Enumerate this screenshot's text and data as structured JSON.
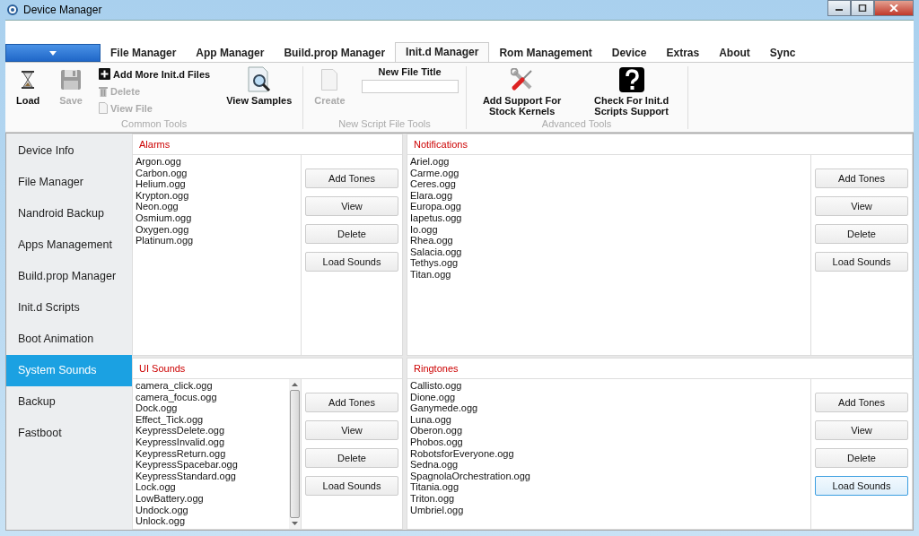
{
  "window": {
    "title": "Device Manager"
  },
  "tabs": [
    {
      "label": "File Manager",
      "selected": false
    },
    {
      "label": "App Manager",
      "selected": false
    },
    {
      "label": "Build.prop Manager",
      "selected": false
    },
    {
      "label": "Init.d Manager",
      "selected": true
    },
    {
      "label": "Rom Management",
      "selected": false
    },
    {
      "label": "Device",
      "selected": false
    },
    {
      "label": "Extras",
      "selected": false
    },
    {
      "label": "About",
      "selected": false
    },
    {
      "label": "Sync",
      "selected": false
    }
  ],
  "ribbon": [
    {
      "label": "Common Tools",
      "tools": [
        {
          "kind": "load",
          "label": "Load",
          "disabled": false
        },
        {
          "kind": "save",
          "label": "Save",
          "disabled": true
        },
        {
          "kind": "stack",
          "items": [
            {
              "kind": "add",
              "label": "Add More Init.d Files",
              "disabled": false
            },
            {
              "kind": "delete",
              "label": "Delete",
              "disabled": true
            },
            {
              "kind": "viewfile",
              "label": "View File",
              "disabled": true
            }
          ]
        },
        {
          "kind": "samples",
          "label": "View Samples",
          "disabled": false
        }
      ]
    },
    {
      "label": "New Script File Tools",
      "tools": [
        {
          "kind": "create",
          "label": "Create",
          "disabled": true
        },
        {
          "kind": "field",
          "label": "New File Title"
        }
      ]
    },
    {
      "label": "Advanced Tools",
      "tools": [
        {
          "kind": "kernels",
          "label": "Add Support For Stock Kernels",
          "disabled": false
        },
        {
          "kind": "check",
          "label": "Check For Init.d Scripts Support",
          "disabled": false
        }
      ]
    }
  ],
  "sidebar": {
    "items": [
      {
        "label": "Device Info",
        "selected": false
      },
      {
        "label": "File Manager",
        "selected": false
      },
      {
        "label": "Nandroid Backup",
        "selected": false
      },
      {
        "label": "Apps Management",
        "selected": false
      },
      {
        "label": "Build.prop Manager",
        "selected": false
      },
      {
        "label": "Init.d Scripts",
        "selected": false
      },
      {
        "label": "Boot Animation",
        "selected": false
      },
      {
        "label": "System Sounds",
        "selected": true
      },
      {
        "label": "Backup",
        "selected": false
      },
      {
        "label": "Fastboot",
        "selected": false
      }
    ]
  },
  "panels": [
    {
      "title": "Alarms",
      "scrollbar": false,
      "files": [
        "Argon.ogg",
        "Carbon.ogg",
        "Helium.ogg",
        "Krypton.ogg",
        "Neon.ogg",
        "Osmium.ogg",
        "Oxygen.ogg",
        "Platinum.ogg"
      ],
      "buttons": [
        {
          "label": "Add Tones",
          "focused": false
        },
        {
          "label": "View",
          "focused": false
        },
        {
          "label": "Delete",
          "focused": false
        },
        {
          "label": "Load Sounds",
          "focused": false
        }
      ]
    },
    {
      "title": "Notifications",
      "scrollbar": false,
      "files": [
        "Ariel.ogg",
        "Carme.ogg",
        "Ceres.ogg",
        "Elara.ogg",
        "Europa.ogg",
        "Iapetus.ogg",
        "Io.ogg",
        "Rhea.ogg",
        "Salacia.ogg",
        "Tethys.ogg",
        "Titan.ogg"
      ],
      "buttons": [
        {
          "label": "Add Tones",
          "focused": false
        },
        {
          "label": "View",
          "focused": false
        },
        {
          "label": "Delete",
          "focused": false
        },
        {
          "label": "Load Sounds",
          "focused": false
        }
      ]
    },
    {
      "title": "UI Sounds",
      "scrollbar": true,
      "files": [
        "camera_click.ogg",
        "camera_focus.ogg",
        "Dock.ogg",
        "Effect_Tick.ogg",
        "KeypressDelete.ogg",
        "KeypressInvalid.ogg",
        "KeypressReturn.ogg",
        "KeypressSpacebar.ogg",
        "KeypressStandard.ogg",
        "Lock.ogg",
        "LowBattery.ogg",
        "Undock.ogg",
        "Unlock.ogg"
      ],
      "buttons": [
        {
          "label": "Add Tones",
          "focused": false
        },
        {
          "label": "View",
          "focused": false
        },
        {
          "label": "Delete",
          "focused": false
        },
        {
          "label": "Load Sounds",
          "focused": false
        }
      ]
    },
    {
      "title": "Ringtones",
      "scrollbar": false,
      "files": [
        "Callisto.ogg",
        "Dione.ogg",
        "Ganymede.ogg",
        "Luna.ogg",
        "Oberon.ogg",
        "Phobos.ogg",
        "RobotsforEveryone.ogg",
        "Sedna.ogg",
        "SpagnolaOrchestration.ogg",
        "Titania.ogg",
        "Triton.ogg",
        "Umbriel.ogg"
      ],
      "buttons": [
        {
          "label": "Add Tones",
          "focused": false
        },
        {
          "label": "View",
          "focused": false
        },
        {
          "label": "Delete",
          "focused": false
        },
        {
          "label": "Load Sounds",
          "focused": true
        }
      ]
    }
  ]
}
